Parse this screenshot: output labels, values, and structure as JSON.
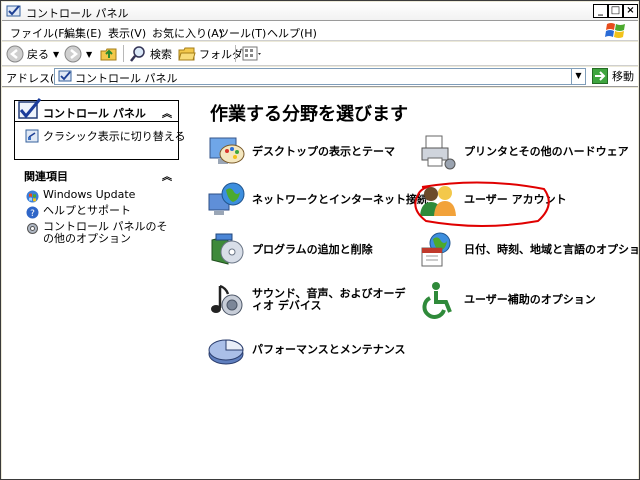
{
  "window": {
    "title": "コントロール パネル"
  },
  "menu": [
    "ファイル(F)",
    "編集(E)",
    "表示(V)",
    "お気に入り(A)",
    "ツール(T)",
    "ヘルプ(H)"
  ],
  "toolbar": {
    "back": "戻る",
    "search": "検索",
    "folders": "フォルダ"
  },
  "address": {
    "label": "アドレス(D)",
    "value": "コントロール パネル",
    "go": "移動"
  },
  "sidebar": {
    "panel_title": "コントロール パネル",
    "switch_link": "クラシック表示に切り替える",
    "related_heading": "関連項目",
    "related": [
      "Windows Update",
      "ヘルプとサポート",
      "コントロール パネルのその他のオプション"
    ]
  },
  "main": {
    "heading": "作業する分野を選びます",
    "categories": [
      "デスクトップの表示とテーマ",
      "プリンタとその他のハードウェア",
      "ネットワークとインターネット接続",
      "ユーザー アカウント",
      "プログラムの追加と削除",
      "日付、時刻、地域と言語のオプション",
      "サウンド、音声、およびオーディオ デバイス",
      "ユーザー補助のオプション",
      "パフォーマンスとメンテナンス"
    ],
    "highlight_color": "#e00000"
  }
}
